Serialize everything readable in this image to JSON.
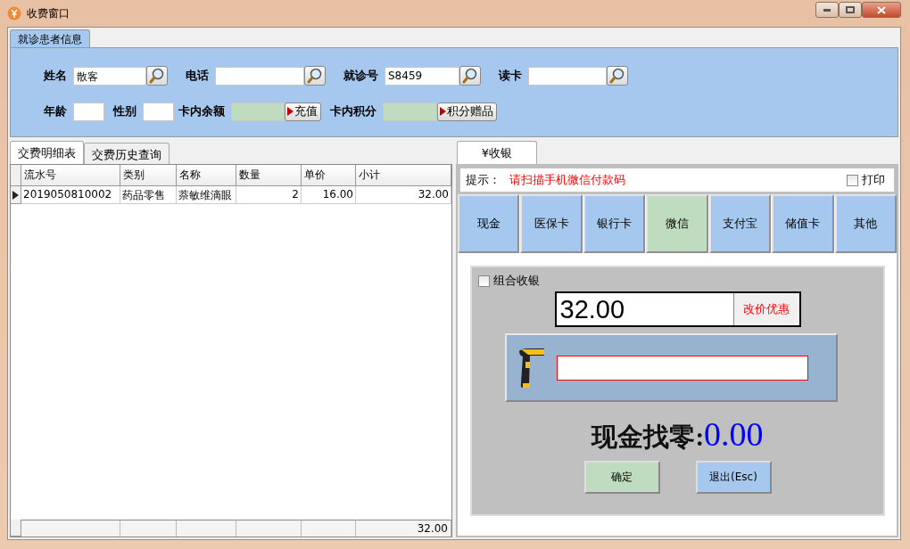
{
  "window": {
    "title": "收费窗口"
  },
  "patient_tabs": [
    {
      "label": "就诊患者信息",
      "selected": true
    }
  ],
  "patient_row_1": [
    {
      "label": "姓名",
      "value": "散客",
      "kind": "search"
    },
    {
      "label": "电话",
      "kind": "search"
    },
    {
      "label": "就诊号",
      "value": "S8459",
      "kind": "search"
    },
    {
      "label": "读卡",
      "kind": "search"
    }
  ],
  "patient_row_2": [
    {
      "label": "年龄",
      "kind": "plain"
    },
    {
      "label": "性别",
      "kind": "plain"
    },
    {
      "label": "卡内余额",
      "kind": "action",
      "action": "充值"
    },
    {
      "label": "卡内积分",
      "kind": "action",
      "action": "积分赠品"
    }
  ],
  "detail_tabs": [
    {
      "label": "交费明细表",
      "selected": true
    },
    {
      "label": "交费历史查询",
      "selected": false
    }
  ],
  "table": {
    "columns": [
      "流水号",
      "类别",
      "名称",
      "数量",
      "单价",
      "小计"
    ],
    "rows": [
      {
        "current": true,
        "cells": [
          "2019050810002",
          "药品零售",
          "萘敏维滴眼",
          "2",
          "16.00",
          "32.00"
        ]
      }
    ],
    "footer_total": "32.00"
  },
  "cashier": {
    "tab": {
      "label": "¥收银",
      "selected": true
    },
    "hint_label": "提示：",
    "hint": "请扫描手机微信付款码",
    "print": {
      "label": "打印",
      "checked": false
    },
    "payment_methods": [
      {
        "label": "现金",
        "selected": false
      },
      {
        "label": "医保卡",
        "selected": false
      },
      {
        "label": "银行卡",
        "selected": false
      },
      {
        "label": "微信",
        "selected": true
      },
      {
        "label": "支付宝",
        "selected": false
      },
      {
        "label": "储值卡",
        "selected": false
      },
      {
        "label": "其他",
        "selected": false
      }
    ],
    "combined": {
      "label": "组合收银",
      "checked": false
    },
    "amount": "32.00",
    "discount_button": "改价优惠",
    "change_label": "现金找零:",
    "change_value": "0.00",
    "buttons": [
      {
        "label": "确定",
        "kind": "confirm"
      },
      {
        "label": "退出(Esc)",
        "kind": "cancel"
      }
    ]
  }
}
